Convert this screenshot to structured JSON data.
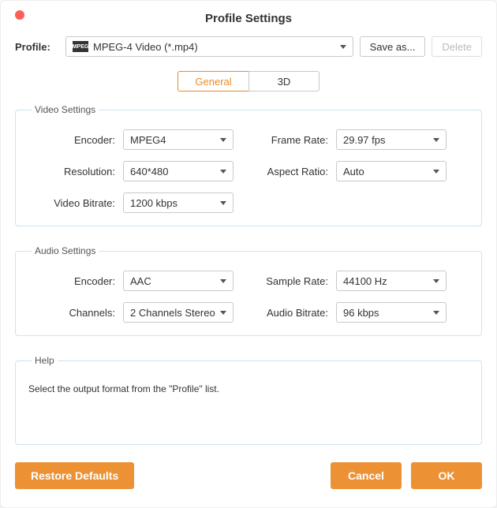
{
  "window": {
    "title": "Profile Settings"
  },
  "profile": {
    "label": "Profile:",
    "selected": "MPEG-4 Video (*.mp4)",
    "icon_text": "MPEG",
    "save_as": "Save as...",
    "delete": "Delete"
  },
  "tabs": {
    "general": "General",
    "three_d": "3D"
  },
  "video": {
    "legend": "Video Settings",
    "encoder_label": "Encoder:",
    "encoder_value": "MPEG4",
    "framerate_label": "Frame Rate:",
    "framerate_value": "29.97 fps",
    "resolution_label": "Resolution:",
    "resolution_value": "640*480",
    "aspect_label": "Aspect Ratio:",
    "aspect_value": "Auto",
    "bitrate_label": "Video Bitrate:",
    "bitrate_value": "1200 kbps"
  },
  "audio": {
    "legend": "Audio Settings",
    "encoder_label": "Encoder:",
    "encoder_value": "AAC",
    "samplerate_label": "Sample Rate:",
    "samplerate_value": "44100 Hz",
    "channels_label": "Channels:",
    "channels_value": "2 Channels Stereo",
    "bitrate_label": "Audio Bitrate:",
    "bitrate_value": "96 kbps"
  },
  "help": {
    "legend": "Help",
    "text": "Select the output format from the \"Profile\" list."
  },
  "footer": {
    "restore": "Restore Defaults",
    "cancel": "Cancel",
    "ok": "OK"
  }
}
